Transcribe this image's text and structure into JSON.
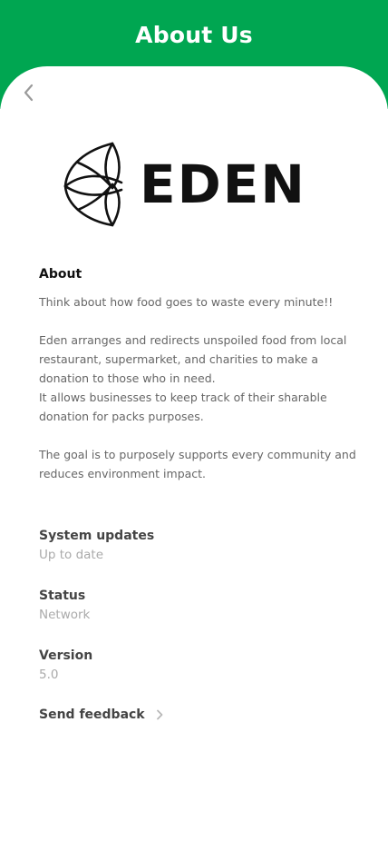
{
  "header": {
    "title": "About Us",
    "color": "#00A651"
  },
  "nav": {
    "back_icon": "chevron-left-icon"
  },
  "logo": {
    "text": "EDEN"
  },
  "about": {
    "heading": "About",
    "paragraphs": [
      "Think about how food goes to waste every minute!!",
      "Eden arranges and redirects unspoiled food from local restaurant, supermarket, and charities to make a donation to those who in need.",
      "It allows businesses to keep track of their sharable donation for packs purposes.",
      "The goal is to purposely supports every community and reduces environment impact."
    ]
  },
  "info": {
    "system_updates": {
      "label": "System updates",
      "value": "Up to date"
    },
    "status": {
      "label": "Status",
      "value": "Network"
    },
    "version": {
      "label": "Version",
      "value": "5.0"
    }
  },
  "feedback": {
    "label": "Send feedback",
    "icon": "chevron-right-icon"
  }
}
